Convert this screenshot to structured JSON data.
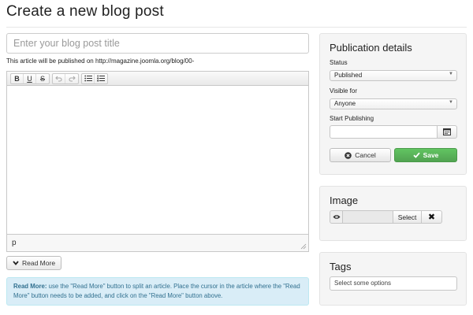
{
  "page": {
    "title": "Create a new blog post"
  },
  "post": {
    "title_placeholder": "Enter your blog post title",
    "title_value": "",
    "publish_note": "This article will be published on http://magazine.joomla.org/blog/00-"
  },
  "editor": {
    "toolbar": {
      "bold": "B",
      "underline": "U",
      "strikethrough": "S"
    },
    "status_path": "p",
    "content": ""
  },
  "readmore": {
    "button_label": "Read More",
    "info_title": "Read More:",
    "info_text": " use the \"Read More\" button to split an article. Place the cursor in the article where the \"Read More\" button needs to be added, and click on the \"Read More\" button above."
  },
  "publication": {
    "title": "Publication details",
    "status_label": "Status",
    "status_value": "Published",
    "visible_label": "Visible for",
    "visible_value": "Anyone",
    "start_label": "Start Publishing",
    "start_value": "",
    "cancel_label": "Cancel",
    "save_label": "Save"
  },
  "image": {
    "title": "Image",
    "select_label": "Select"
  },
  "tags": {
    "title": "Tags",
    "placeholder": "Select some options"
  },
  "colors": {
    "save_green": "#5cb85c",
    "info_bg": "#d9edf7",
    "info_text": "#31708f",
    "panel_bg": "#f5f5f5"
  }
}
